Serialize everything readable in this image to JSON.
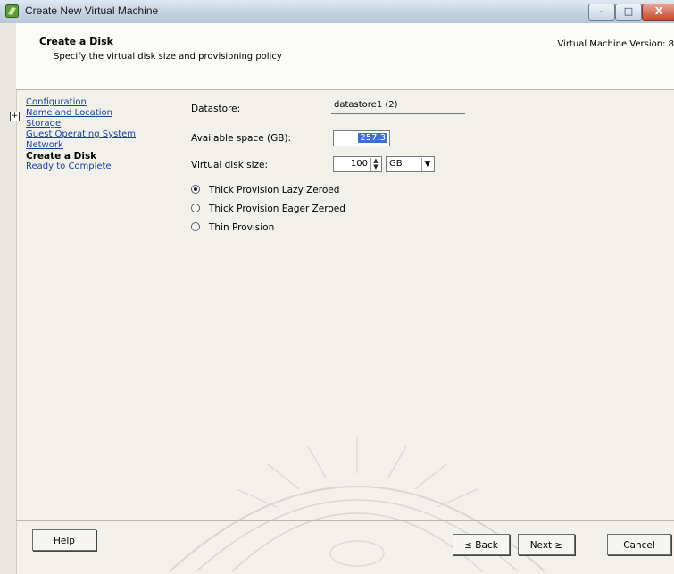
{
  "window": {
    "title": "Create New Virtual Machine",
    "icon": "vsphere-icon",
    "controls": {
      "minimize": "–",
      "maximize": "□",
      "close": "X"
    }
  },
  "header": {
    "title": "Create a Disk",
    "subtitle": "Specify the virtual disk size and provisioning policy",
    "version": "Virtual Machine Version: 8"
  },
  "nav": {
    "items": [
      {
        "label": "Configuration",
        "state": "done"
      },
      {
        "label": "Name and Location",
        "state": "done"
      },
      {
        "label": "Storage",
        "state": "done"
      },
      {
        "label": "Guest Operating System",
        "state": "done"
      },
      {
        "label": "Network",
        "state": "done"
      },
      {
        "label": "Create a Disk",
        "state": "current"
      },
      {
        "label": "Ready to Complete",
        "state": "pending"
      }
    ]
  },
  "form": {
    "datastore_label": "Datastore:",
    "datastore_value": "datastore1 (2)",
    "available_label": "Available space (GB):",
    "available_value": "257.3",
    "disk_size_label": "Virtual disk size:",
    "disk_size_value": "100",
    "disk_unit": "GB",
    "provisioning": [
      {
        "label": "Thick Provision Lazy Zeroed",
        "checked": true
      },
      {
        "label": "Thick Provision Eager Zeroed",
        "checked": false
      },
      {
        "label": "Thin Provision",
        "checked": false
      }
    ]
  },
  "footer": {
    "help": "Help",
    "back": "≤ Back",
    "next": "Next ≥",
    "cancel": "Cancel"
  }
}
